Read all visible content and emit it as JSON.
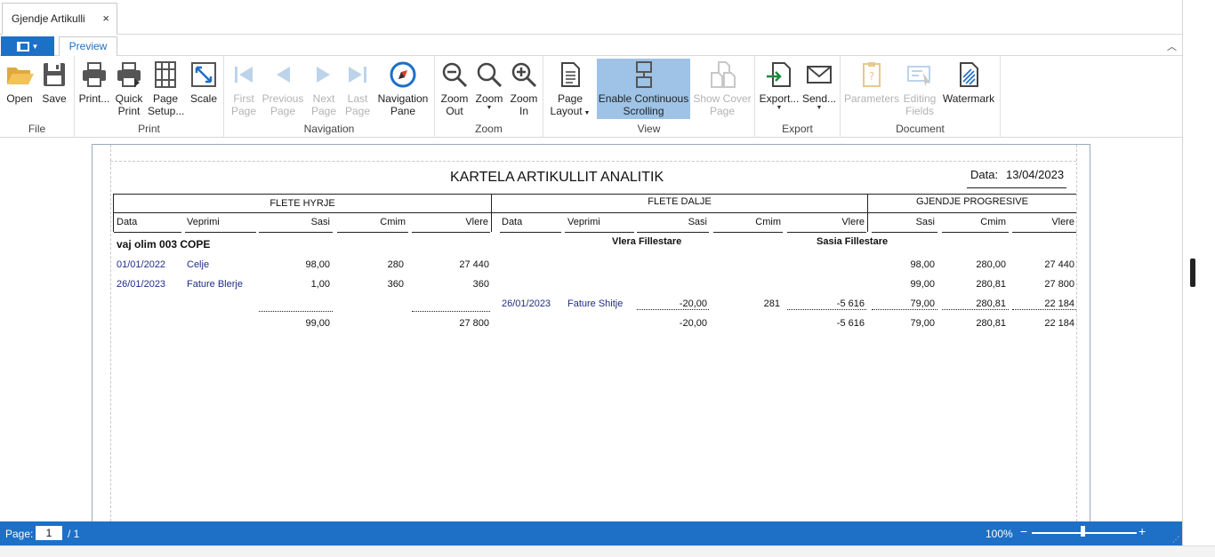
{
  "document_tab": {
    "title": "Gjendje Artikulli",
    "close": "×"
  },
  "ribbon_tabs": {
    "active": "Preview"
  },
  "ribbon": {
    "file": {
      "label": "File",
      "open": "Open",
      "save": "Save"
    },
    "print": {
      "label": "Print",
      "print": "Print...",
      "quick_print_1": "Quick",
      "quick_print_2": "Print",
      "page_setup_1": "Page",
      "page_setup_2": "Setup...",
      "scale": "Scale"
    },
    "navigation": {
      "label": "Navigation",
      "first_1": "First",
      "first_2": "Page",
      "prev_1": "Previous",
      "prev_2": "Page",
      "next_1": "Next",
      "next_2": "Page",
      "last_1": "Last",
      "last_2": "Page",
      "nav_pane_1": "Navigation",
      "nav_pane_2": "Pane"
    },
    "zoom": {
      "label": "Zoom",
      "out_1": "Zoom",
      "out_2": "Out",
      "zoom": "Zoom",
      "in_1": "Zoom",
      "in_2": "In"
    },
    "view": {
      "label": "View",
      "page_layout_1": "Page",
      "page_layout_2": "Layout",
      "continuous_1": "Enable Continuous",
      "continuous_2": "Scrolling",
      "cover_1": "Show Cover",
      "cover_2": "Page"
    },
    "export": {
      "label": "Export",
      "export": "Export...",
      "send": "Send..."
    },
    "document": {
      "label": "Document",
      "parameters": "Parameters",
      "editing_1": "Editing",
      "editing_2": "Fields",
      "watermark": "Watermark"
    }
  },
  "report": {
    "title": "KARTELA ARTIKULLIT ANALITIK",
    "date_label": "Data:",
    "date_value": "13/04/2023",
    "sections": {
      "in": "FLETE HYRJE",
      "out": "FLETE DALJE",
      "stock": "GJENDJE PROGRESIVE"
    },
    "columns": {
      "in": [
        "Data",
        "Veprimi",
        "Sasi",
        "Cmim",
        "Vlere"
      ],
      "out": [
        "Data",
        "Veprimi",
        "Sasi",
        "Cmim",
        "Vlere"
      ],
      "stock": [
        "Sasi",
        "Cmim",
        "Vlere"
      ]
    },
    "item_name": "vaj olim  003  COPE",
    "opening_value_label": "Vlera Fillestare",
    "opening_qty_label": "Sasia Fillestare",
    "rows": [
      {
        "in_date": "01/01/2022",
        "in_op": "Celje",
        "in_qty": "98,00",
        "in_price": "280",
        "in_value": "27 440",
        "out_date": "",
        "out_op": "",
        "out_qty": "",
        "out_price": "",
        "out_value": "",
        "st_qty": "98,00",
        "st_price": "280,00",
        "st_value": "27 440"
      },
      {
        "in_date": "26/01/2023",
        "in_op": "Fature Blerje",
        "in_qty": "1,00",
        "in_price": "360",
        "in_value": "360",
        "out_date": "",
        "out_op": "",
        "out_qty": "",
        "out_price": "",
        "out_value": "",
        "st_qty": "99,00",
        "st_price": "280,81",
        "st_value": "27 800"
      },
      {
        "in_date": "",
        "in_op": "",
        "in_qty": "",
        "in_price": "",
        "in_value": "",
        "out_date": "26/01/2023",
        "out_op": "Fature Shitje",
        "out_qty": "-20,00",
        "out_price": "281",
        "out_value": "-5 616",
        "st_qty": "79,00",
        "st_price": "280,81",
        "st_value": "22 184"
      }
    ],
    "totals": {
      "in_qty": "99,00",
      "in_value": "27 800",
      "out_qty": "-20,00",
      "out_value": "-5 616",
      "st_qty": "79,00",
      "st_price": "280,81",
      "st_value": "22 184"
    }
  },
  "status": {
    "page_label": "Page:",
    "page_current": "1",
    "page_total": "/ 1",
    "zoom": "100%",
    "zoom_fraction": 0.48
  }
}
